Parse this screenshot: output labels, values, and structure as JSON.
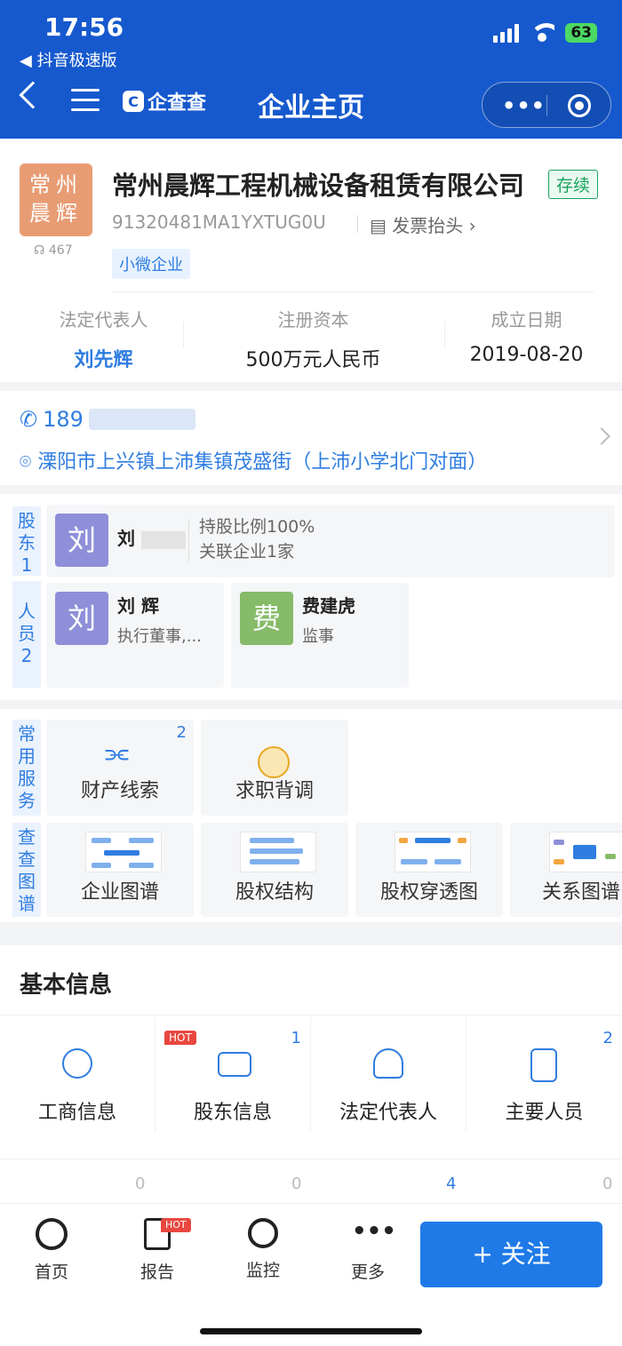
{
  "status_bar": {
    "time": "17:56",
    "back_app": "◀ 抖音极速版",
    "battery": "63"
  },
  "nav": {
    "logo_text": "企查查",
    "title": "企业主页",
    "more": "•••"
  },
  "company": {
    "avatar_text": "常州晨辉",
    "views": "467",
    "name": "常州晨辉工程机械设备租赁有限公司",
    "status": "存续",
    "credit_code": "91320481MA1YXTUG0U",
    "invoice": "发票抬头",
    "scale_tag": "小微企业",
    "legal_rep_label": "法定代表人",
    "legal_rep": "刘先辉",
    "capital_label": "注册资本",
    "capital": "500万元人民币",
    "founded_label": "成立日期",
    "founded": "2019-08-20"
  },
  "contact": {
    "phone_prefix": "189",
    "address": "溧阳市上兴镇上沛集镇茂盛街（上沛小学北门对面）"
  },
  "shareholders": {
    "label": "股东1",
    "items": [
      {
        "avatar": "刘",
        "name_part": "刘",
        "ratio": "持股比例100%",
        "related": "关联企业1家"
      }
    ]
  },
  "staff": {
    "label": "人员2",
    "items": [
      {
        "avatar": "刘",
        "name": "刘 辉",
        "role": "执行董事,...",
        "color": "#8e8fd8"
      },
      {
        "avatar": "费",
        "name": "费建虎",
        "role": "监事",
        "color": "#86bb6a"
      }
    ]
  },
  "services": {
    "common_label": "常用服务",
    "common": [
      {
        "label": "财产线索",
        "count": "2"
      },
      {
        "label": "求职背调",
        "count": ""
      }
    ],
    "graph_label": "查查图谱",
    "graphs": [
      {
        "label": "企业图谱"
      },
      {
        "label": "股权结构"
      },
      {
        "label": "股权穿透图"
      },
      {
        "label": "关系图谱"
      }
    ]
  },
  "basic_info": {
    "title": "基本信息",
    "row1": [
      {
        "label": "工商信息",
        "count": "",
        "hot": ""
      },
      {
        "label": "股东信息",
        "count": "1",
        "hot": "HOT"
      },
      {
        "label": "法定代表人",
        "count": "",
        "hot": ""
      },
      {
        "label": "主要人员",
        "count": "2",
        "hot": ""
      }
    ],
    "row2_counts": [
      "0",
      "0",
      "4",
      "0"
    ]
  },
  "tabbar": {
    "tabs": [
      {
        "label": "首页"
      },
      {
        "label": "报告",
        "hot": "HOT"
      },
      {
        "label": "监控"
      },
      {
        "label": "更多"
      }
    ],
    "follow": "+ 关注"
  },
  "colors": {
    "primary": "#1659ce",
    "accent": "#2f7de1",
    "status_green": "#1aa35e",
    "hot_red": "#e8473f"
  }
}
